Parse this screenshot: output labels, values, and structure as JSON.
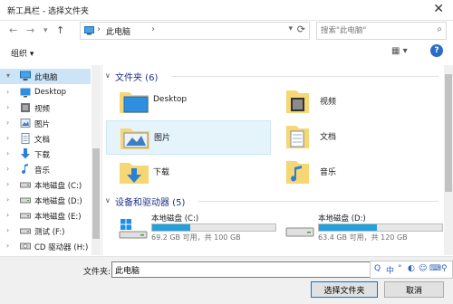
{
  "window": {
    "title": "新工具栏 - 选择文件夹",
    "close": "✕"
  },
  "navigation": {
    "back": "←",
    "forward": "→",
    "recent": "▾",
    "up": "↑",
    "address": {
      "crumb": "此电脑",
      "separator": "›",
      "dropdown": "▾",
      "refresh": "⟳"
    },
    "search": {
      "placeholder": "搜索\"此电脑\"",
      "icon": "⌕"
    }
  },
  "toolbar": {
    "organize": "组织 ▾",
    "view": "▦ ▾",
    "help": "?"
  },
  "sidebar": {
    "items": [
      {
        "label": "此电脑",
        "icon": "pc-icon",
        "arrow": "▾"
      },
      {
        "label": "Desktop",
        "icon": "desktop-folder-icon",
        "arrow": "›"
      },
      {
        "label": "视频",
        "icon": "video-folder-icon",
        "arrow": "›"
      },
      {
        "label": "图片",
        "icon": "picture-folder-icon",
        "arrow": "›"
      },
      {
        "label": "文档",
        "icon": "document-folder-icon",
        "arrow": "›"
      },
      {
        "label": "下载",
        "icon": "download-icon",
        "arrow": "›"
      },
      {
        "label": "音乐",
        "icon": "music-icon",
        "arrow": "›"
      },
      {
        "label": "本地磁盘 (C:)",
        "icon": "drive-icon",
        "arrow": "›"
      },
      {
        "label": "本地磁盘 (D:)",
        "icon": "drive-icon",
        "arrow": "›"
      },
      {
        "label": "本地磁盘 (E:)",
        "icon": "drive-icon",
        "arrow": "›"
      },
      {
        "label": "测试 (F:)",
        "icon": "drive-icon",
        "arrow": "›"
      },
      {
        "label": "CD 驱动器 (H:)",
        "icon": "cd-drive-icon",
        "arrow": "›"
      }
    ]
  },
  "folders_group": {
    "heading": "文件夹 (6)",
    "items": [
      {
        "label": "Desktop",
        "icon": "desktop-folder-icon"
      },
      {
        "label": "视频",
        "icon": "video-folder-icon"
      },
      {
        "label": "图片",
        "icon": "picture-folder-icon"
      },
      {
        "label": "文档",
        "icon": "document-folder-icon"
      },
      {
        "label": "下载",
        "icon": "download-folder-icon"
      },
      {
        "label": "音乐",
        "icon": "music-folder-icon"
      }
    ]
  },
  "drives_group": {
    "heading": "设备和驱动器 (5)",
    "items": [
      {
        "label": "本地磁盘 (C:)",
        "size": "69.2 GB 可用，共 100 GB",
        "used_fraction": 0.31,
        "icon": "windows-drive-icon"
      },
      {
        "label": "本地磁盘 (D:)",
        "size": "63.4 GB 可用，共 120 GB",
        "used_fraction": 0.47,
        "icon": "drive-icon"
      }
    ]
  },
  "bottom": {
    "filename_label": "文件夹:",
    "filename_value": "此电脑",
    "ime": [
      "Q",
      "中",
      "°",
      "◐",
      "☺",
      "⌨",
      "⚲"
    ],
    "select_button": "选择文件夹",
    "cancel_button": "取消"
  },
  "colors": {
    "accent": "#0078d7",
    "selected_nav": "#cce4f7",
    "group_heading": "#1e3287",
    "drive_fill": "#26a0da"
  }
}
